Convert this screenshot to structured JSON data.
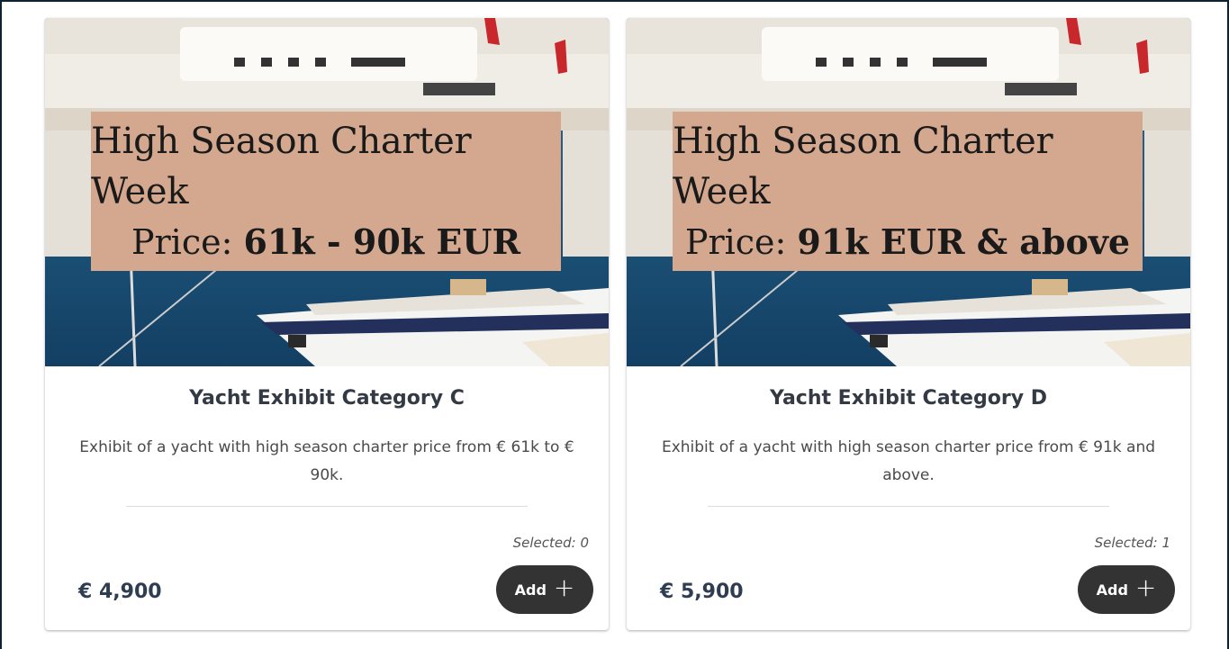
{
  "cards": [
    {
      "banner_line1": "High Season Charter Week",
      "banner_price_prefix": "Price: ",
      "banner_price_value": "61k - 90k EUR",
      "title": "Yacht Exhibit Category C",
      "description": "Exhibit of a yacht with high season charter price from € 61k to € 90k.",
      "selected": "Selected: 0",
      "price": "€ 4,900",
      "add_label": "Add",
      "add_icon": "plus-icon"
    },
    {
      "banner_line1": "High Season Charter Week",
      "banner_price_prefix": "Price: ",
      "banner_price_value": "91k EUR & above",
      "title": "Yacht Exhibit Category D",
      "description": "Exhibit of a yacht with high season charter price from € 91k and above.",
      "selected": "Selected: 1",
      "price": "€ 5,900",
      "add_label": "Add",
      "add_icon": "plus-icon"
    }
  ],
  "colors": {
    "banner_bg": "#d4a88e",
    "button_bg": "#333333",
    "water": "#1f5d86",
    "price_text": "#2f3d52"
  }
}
